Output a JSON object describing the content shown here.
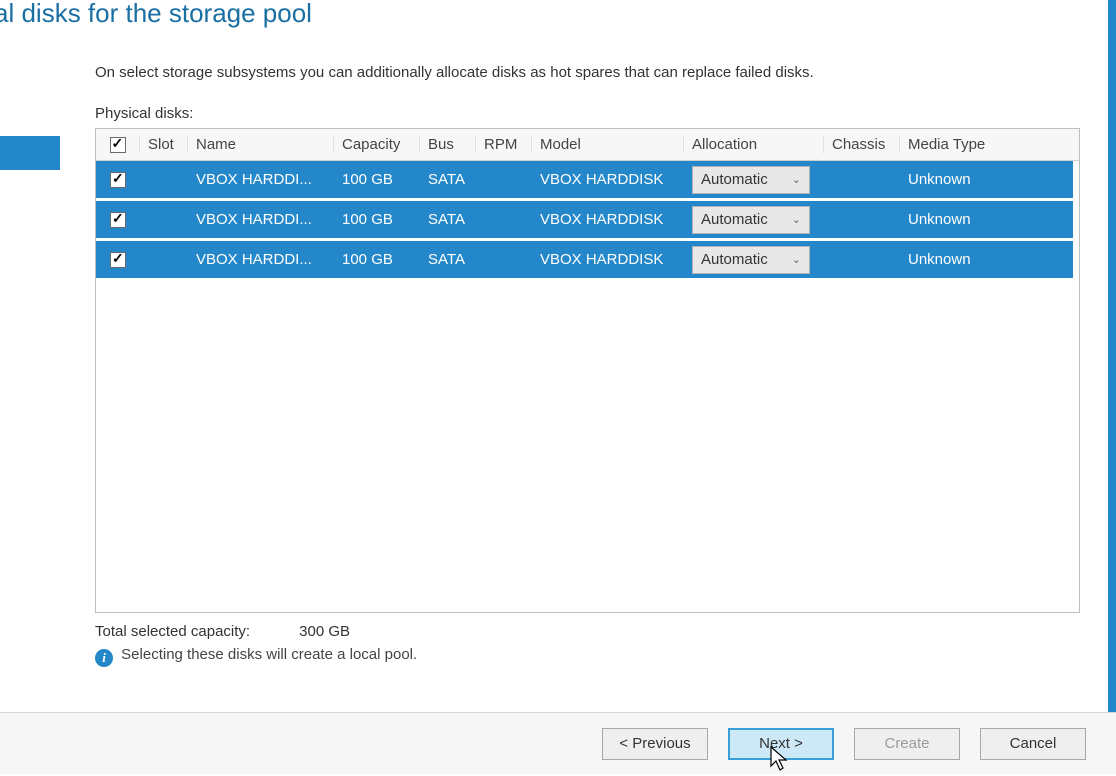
{
  "header": {
    "title_fragment": "al disks for the storage pool"
  },
  "main": {
    "intro_text": "On select storage subsystems you can additionally allocate disks as hot spares that can replace failed disks.",
    "grid_label": "Physical disks:",
    "columns": {
      "slot": "Slot",
      "name": "Name",
      "capacity": "Capacity",
      "bus": "Bus",
      "rpm": "RPM",
      "model": "Model",
      "allocation": "Allocation",
      "chassis": "Chassis",
      "media": "Media Type"
    },
    "rows": [
      {
        "checked": true,
        "slot": "",
        "name": "VBOX HARDDI...",
        "capacity": "100 GB",
        "bus": "SATA",
        "rpm": "",
        "model": "VBOX HARDDISK",
        "allocation": "Automatic",
        "chassis": "",
        "media": "Unknown"
      },
      {
        "checked": true,
        "slot": "",
        "name": "VBOX HARDDI...",
        "capacity": "100 GB",
        "bus": "SATA",
        "rpm": "",
        "model": "VBOX HARDDISK",
        "allocation": "Automatic",
        "chassis": "",
        "media": "Unknown"
      },
      {
        "checked": true,
        "slot": "",
        "name": "VBOX HARDDI...",
        "capacity": "100 GB",
        "bus": "SATA",
        "rpm": "",
        "model": "VBOX HARDDISK",
        "allocation": "Automatic",
        "chassis": "",
        "media": "Unknown"
      }
    ],
    "totals_label": "Total selected capacity:",
    "totals_value": "300 GB",
    "info_text": "Selecting these disks will create a local pool."
  },
  "footer": {
    "previous": "< Previous",
    "next": "Next >",
    "create": "Create",
    "cancel": "Cancel"
  }
}
